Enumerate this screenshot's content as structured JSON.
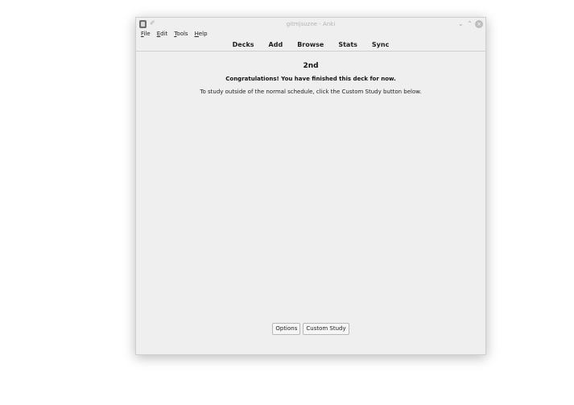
{
  "window": {
    "title": "gitmjsuzne - Anki"
  },
  "titlebar": {
    "minimize_glyph": "⌄",
    "maximize_glyph": "⌃",
    "close_glyph": "×"
  },
  "menubar": {
    "items": [
      {
        "accel": "F",
        "rest": "ile"
      },
      {
        "accel": "E",
        "rest": "dit"
      },
      {
        "accel": "T",
        "rest": "ools"
      },
      {
        "accel": "H",
        "rest": "elp"
      }
    ]
  },
  "toolbar": {
    "decks": "Decks",
    "add": "Add",
    "browse": "Browse",
    "stats": "Stats",
    "sync": "Sync"
  },
  "deck": {
    "name": "2nd",
    "congrats": "Congratulations! You have finished this deck for now.",
    "hint": "To study outside of the normal schedule, click the Custom Study button below."
  },
  "buttons": {
    "options": "Options",
    "custom_study": "Custom Study"
  },
  "icons": {
    "app": "anki-app-icon",
    "pin": "pin-icon"
  }
}
